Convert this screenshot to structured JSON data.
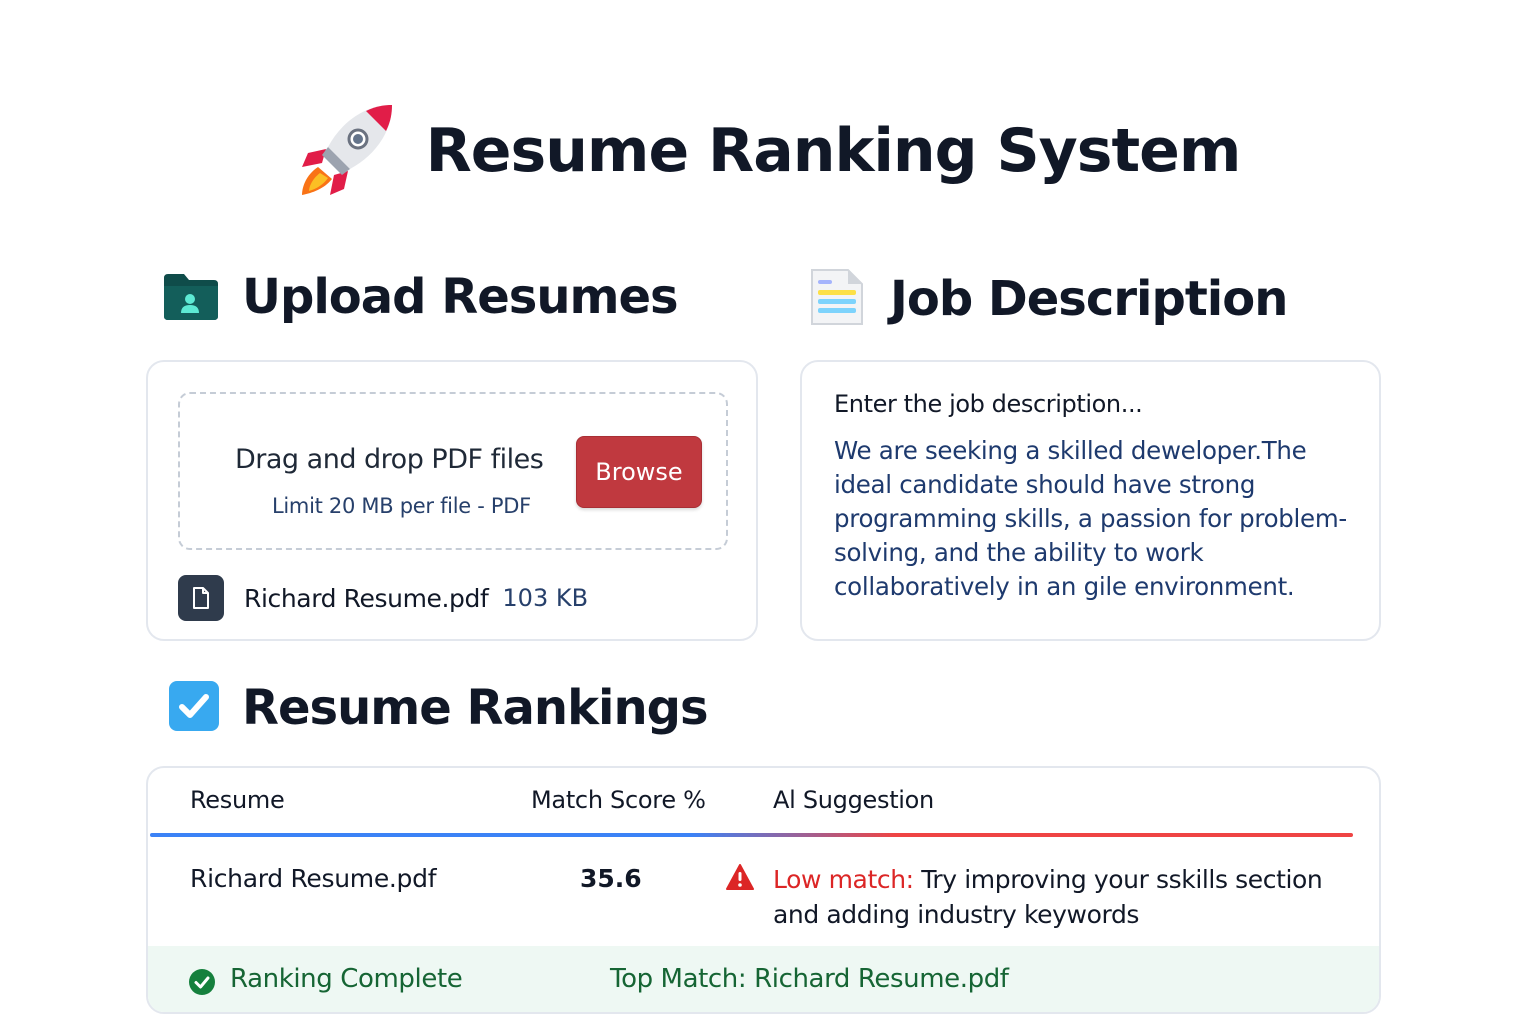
{
  "app": {
    "title": "Resume Ranking System",
    "icon": "rocket-icon"
  },
  "upload": {
    "heading": "Upload Resumes",
    "icon": "folder-icon",
    "dropzone_title": "Drag and drop PDF files",
    "dropzone_limit": "Limit 20 MB per file - PDF",
    "browse_label": "Browse",
    "file": {
      "name": "Richard Resume.pdf",
      "size": "103 KB",
      "icon": "file-icon"
    }
  },
  "job": {
    "heading": "Job Description",
    "icon": "document-icon",
    "placeholder": "Enter the job description...",
    "text": "We are seeking a skilled deweloper.The ideal candidate should have strong programming skills, a passion for problem-solving, and the ability to work collaboratively in an gile environment."
  },
  "rankings": {
    "heading": "Resume Rankings",
    "icon": "checkbox-icon",
    "columns": [
      "Resume",
      "Match Score %",
      "Al Suggestion"
    ],
    "rows": [
      {
        "resume": "Richard Resume.pdf",
        "score": "35.6",
        "suggestion_label": "Low match:",
        "suggestion_text": " Try improving your sskills section and adding industry keywords"
      }
    ],
    "status": "Ranking Complete",
    "top_match": "Top Match: Richard Resume.pdf"
  },
  "colors": {
    "browse_button": "#c0393f",
    "low_match": "#dc2626",
    "success": "#166534",
    "status_bg": "#eef8f3",
    "job_text": "#1e3a6e"
  }
}
